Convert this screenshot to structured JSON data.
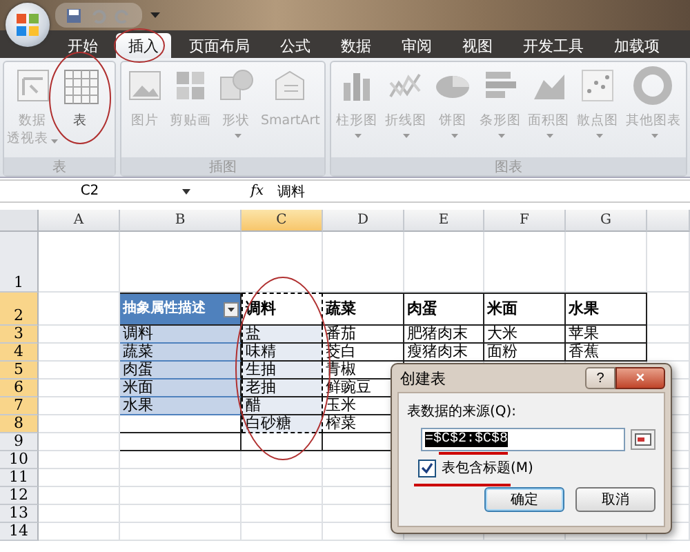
{
  "tabs": [
    {
      "label": "开始",
      "selected": false
    },
    {
      "label": "插入",
      "selected": true
    },
    {
      "label": "页面布局",
      "selected": false
    },
    {
      "label": "公式",
      "selected": false
    },
    {
      "label": "数据",
      "selected": false
    },
    {
      "label": "审阅",
      "selected": false
    },
    {
      "label": "视图",
      "selected": false
    },
    {
      "label": "开发工具",
      "selected": false
    },
    {
      "label": "加载项",
      "selected": false
    }
  ],
  "ribbon_groups": [
    {
      "label": "表",
      "buttons": [
        {
          "kind": "pivot",
          "label_lines": [
            "数据",
            "透视表"
          ],
          "dropdown": true,
          "disabled": true
        },
        {
          "kind": "table",
          "label_lines": [
            "表"
          ],
          "dropdown": false,
          "disabled": false
        }
      ]
    },
    {
      "label": "插图",
      "buttons": [
        {
          "kind": "picture",
          "label_lines": [
            "图片"
          ],
          "dropdown": false,
          "disabled": true
        },
        {
          "kind": "clipart",
          "label_lines": [
            "剪贴画"
          ],
          "dropdown": false,
          "disabled": true
        },
        {
          "kind": "shapes",
          "label_lines": [
            "形状"
          ],
          "dropdown": true,
          "disabled": true
        },
        {
          "kind": "smartart",
          "label_lines": [
            "SmartArt"
          ],
          "dropdown": false,
          "disabled": true
        }
      ]
    },
    {
      "label": "图表",
      "buttons": [
        {
          "kind": "column",
          "label_lines": [
            "柱形图"
          ],
          "dropdown": true,
          "disabled": true
        },
        {
          "kind": "line",
          "label_lines": [
            "折线图"
          ],
          "dropdown": true,
          "disabled": true
        },
        {
          "kind": "pie",
          "label_lines": [
            "饼图"
          ],
          "dropdown": true,
          "disabled": true
        },
        {
          "kind": "bar",
          "label_lines": [
            "条形图"
          ],
          "dropdown": true,
          "disabled": true
        },
        {
          "kind": "area",
          "label_lines": [
            "面积图"
          ],
          "dropdown": true,
          "disabled": true
        },
        {
          "kind": "scatter",
          "label_lines": [
            "散点图"
          ],
          "dropdown": true,
          "disabled": true
        },
        {
          "kind": "other",
          "label_lines": [
            "其他图表"
          ],
          "dropdown": true,
          "disabled": true
        }
      ]
    }
  ],
  "formula_bar": {
    "name_box": "C2",
    "function_label": "fx",
    "formula": "调料"
  },
  "columns": [
    {
      "label": "A",
      "selected": false
    },
    {
      "label": "B",
      "selected": false
    },
    {
      "label": "C",
      "selected": true
    },
    {
      "label": "D",
      "selected": false
    },
    {
      "label": "E",
      "selected": false
    },
    {
      "label": "F",
      "selected": false
    },
    {
      "label": "G",
      "selected": false
    }
  ],
  "rows": [
    {
      "label": "1",
      "selected": false
    },
    {
      "label": "2",
      "selected": true,
      "cells": [
        {
          "kind": "blank"
        },
        {
          "kind": "table-header",
          "text": "抽象属性描述"
        },
        {
          "kind": "header",
          "text": "调料",
          "marked": true
        },
        {
          "kind": "header",
          "text": "蔬菜"
        },
        {
          "kind": "header",
          "text": "肉蛋"
        },
        {
          "kind": "header",
          "text": "米面"
        },
        {
          "kind": "header",
          "text": "水果"
        }
      ]
    },
    {
      "label": "3",
      "selected": true,
      "cells": [
        {
          "kind": "blank"
        },
        {
          "kind": "table-row",
          "text": "调料"
        },
        {
          "kind": "highlight",
          "text": "盐",
          "marked": true
        },
        {
          "kind": "plain",
          "text": "番茄"
        },
        {
          "kind": "plain",
          "text": "肥猪肉末"
        },
        {
          "kind": "plain",
          "text": "大米"
        },
        {
          "kind": "plain",
          "text": "苹果"
        }
      ]
    },
    {
      "label": "4",
      "selected": true,
      "cells": [
        {
          "kind": "blank"
        },
        {
          "kind": "table-row",
          "text": "蔬菜"
        },
        {
          "kind": "highlight",
          "text": "味精",
          "marked": true
        },
        {
          "kind": "plain",
          "text": "茭白"
        },
        {
          "kind": "plain",
          "text": "瘦猪肉末"
        },
        {
          "kind": "plain",
          "text": "面粉"
        },
        {
          "kind": "plain",
          "text": "香蕉"
        }
      ]
    },
    {
      "label": "5",
      "selected": true,
      "cells": [
        {
          "kind": "blank"
        },
        {
          "kind": "table-row",
          "text": "肉蛋"
        },
        {
          "kind": "highlight",
          "text": "生抽",
          "marked": true
        },
        {
          "kind": "plain",
          "text": "青椒"
        }
      ]
    },
    {
      "label": "6",
      "selected": true,
      "cells": [
        {
          "kind": "blank"
        },
        {
          "kind": "table-row",
          "text": "米面"
        },
        {
          "kind": "highlight",
          "text": "老抽",
          "marked": true
        },
        {
          "kind": "plain",
          "text": "鲜豌豆"
        }
      ]
    },
    {
      "label": "7",
      "selected": true,
      "cells": [
        {
          "kind": "blank"
        },
        {
          "kind": "table-row",
          "text": "水果"
        },
        {
          "kind": "highlight",
          "text": "醋",
          "marked": true
        },
        {
          "kind": "plain",
          "text": "玉米"
        }
      ]
    },
    {
      "label": "8",
      "selected": true,
      "cells": [
        {
          "kind": "blank"
        },
        {
          "kind": "box"
        },
        {
          "kind": "highlight",
          "text": "白砂糖",
          "marked": true
        },
        {
          "kind": "plain",
          "text": "榨菜"
        }
      ]
    },
    {
      "label": "9",
      "selected": false,
      "cells": [
        {
          "kind": "blank"
        },
        {
          "kind": "box"
        },
        {
          "kind": "box"
        },
        {
          "kind": "box"
        }
      ]
    },
    {
      "label": "10",
      "selected": false,
      "cells": [
        {
          "kind": "blank"
        },
        {
          "kind": "blank"
        },
        {
          "kind": "blank"
        },
        {
          "kind": "blank"
        }
      ]
    },
    {
      "label": "11",
      "selected": false,
      "cells": [
        {
          "kind": "blank"
        },
        {
          "kind": "blank"
        },
        {
          "kind": "blank"
        },
        {
          "kind": "blank"
        }
      ]
    },
    {
      "label": "12",
      "selected": false,
      "cells": [
        {
          "kind": "blank"
        },
        {
          "kind": "blank"
        },
        {
          "kind": "blank"
        },
        {
          "kind": "blank"
        }
      ]
    },
    {
      "label": "13",
      "selected": false,
      "cells": [
        {
          "kind": "blank"
        },
        {
          "kind": "blank"
        },
        {
          "kind": "blank"
        },
        {
          "kind": "blank"
        }
      ]
    },
    {
      "label": "14",
      "selected": false
    }
  ],
  "dialog": {
    "title": "创建表",
    "help": "?",
    "close": "×",
    "source_label": "表数据的来源(Q):",
    "source_value": "=$C$2:$C$8",
    "header_checkbox": {
      "label": "表包含标题(M)",
      "checked": true
    },
    "buttons": [
      {
        "label": "确定",
        "selected": true
      },
      {
        "label": "取消",
        "selected": false
      }
    ]
  }
}
